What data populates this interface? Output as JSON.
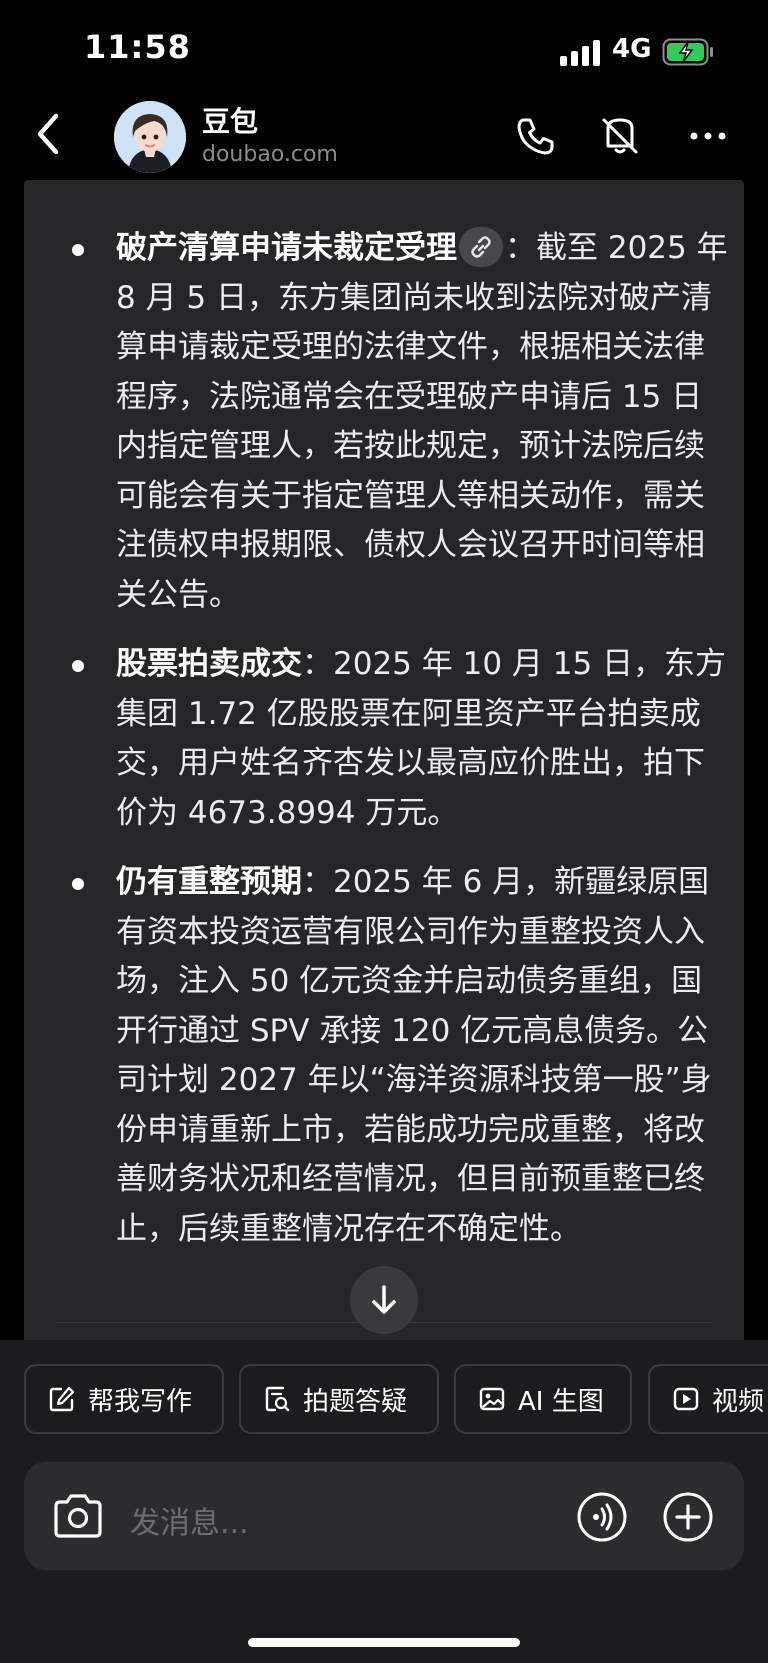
{
  "status_bar": {
    "time": "11:58",
    "network": "4G"
  },
  "header": {
    "title": "豆包",
    "subtitle": "doubao.com"
  },
  "message": {
    "bullets": [
      {
        "heading": "破产清算申请未裁定受理",
        "text": "：截至 2025 年 8 月 5 日，东方集团尚未收到法院对破产清算申请裁定受理的法律文件，根据相关法律程序，法院通常会在受理破产申请后 15 日内指定管理人，若按此规定，预计法院后续可能会有关于指定管理人等相关动作，需关注债权申报期限、债权人会议召开时间等相关公告。"
      },
      {
        "heading": "股票拍卖成交",
        "text": "：2025 年 10 月 15 日，东方集团 1.72 亿股股票在阿里资产平台拍卖成交，用户姓名齐杏发以最高应价胜出，拍下价为 4673.8994 万元。"
      },
      {
        "heading": "仍有重整预期",
        "text": "：2025 年 6 月，新疆绿原国有资本投资运营有限公司作为重整投资人入场，注入 50 亿元资金并启动债务重组，国开行通过 SPV 承接 120 亿元高息债务。公司计划 2027 年以“海洋资源科技第一股”身份申请重新上市，若能成功完成重整，将改善财务状况和经营情况，但目前预重整已终止，后续重整情况存在不确定性。"
      }
    ]
  },
  "quick_actions": [
    {
      "label": "帮我写作",
      "icon": "edit-icon"
    },
    {
      "label": "拍题答疑",
      "icon": "scan-question-icon"
    },
    {
      "label": "AI 生图",
      "icon": "image-icon"
    },
    {
      "label": "视频",
      "icon": "video-icon"
    }
  ],
  "composer": {
    "placeholder": "发消息..."
  }
}
